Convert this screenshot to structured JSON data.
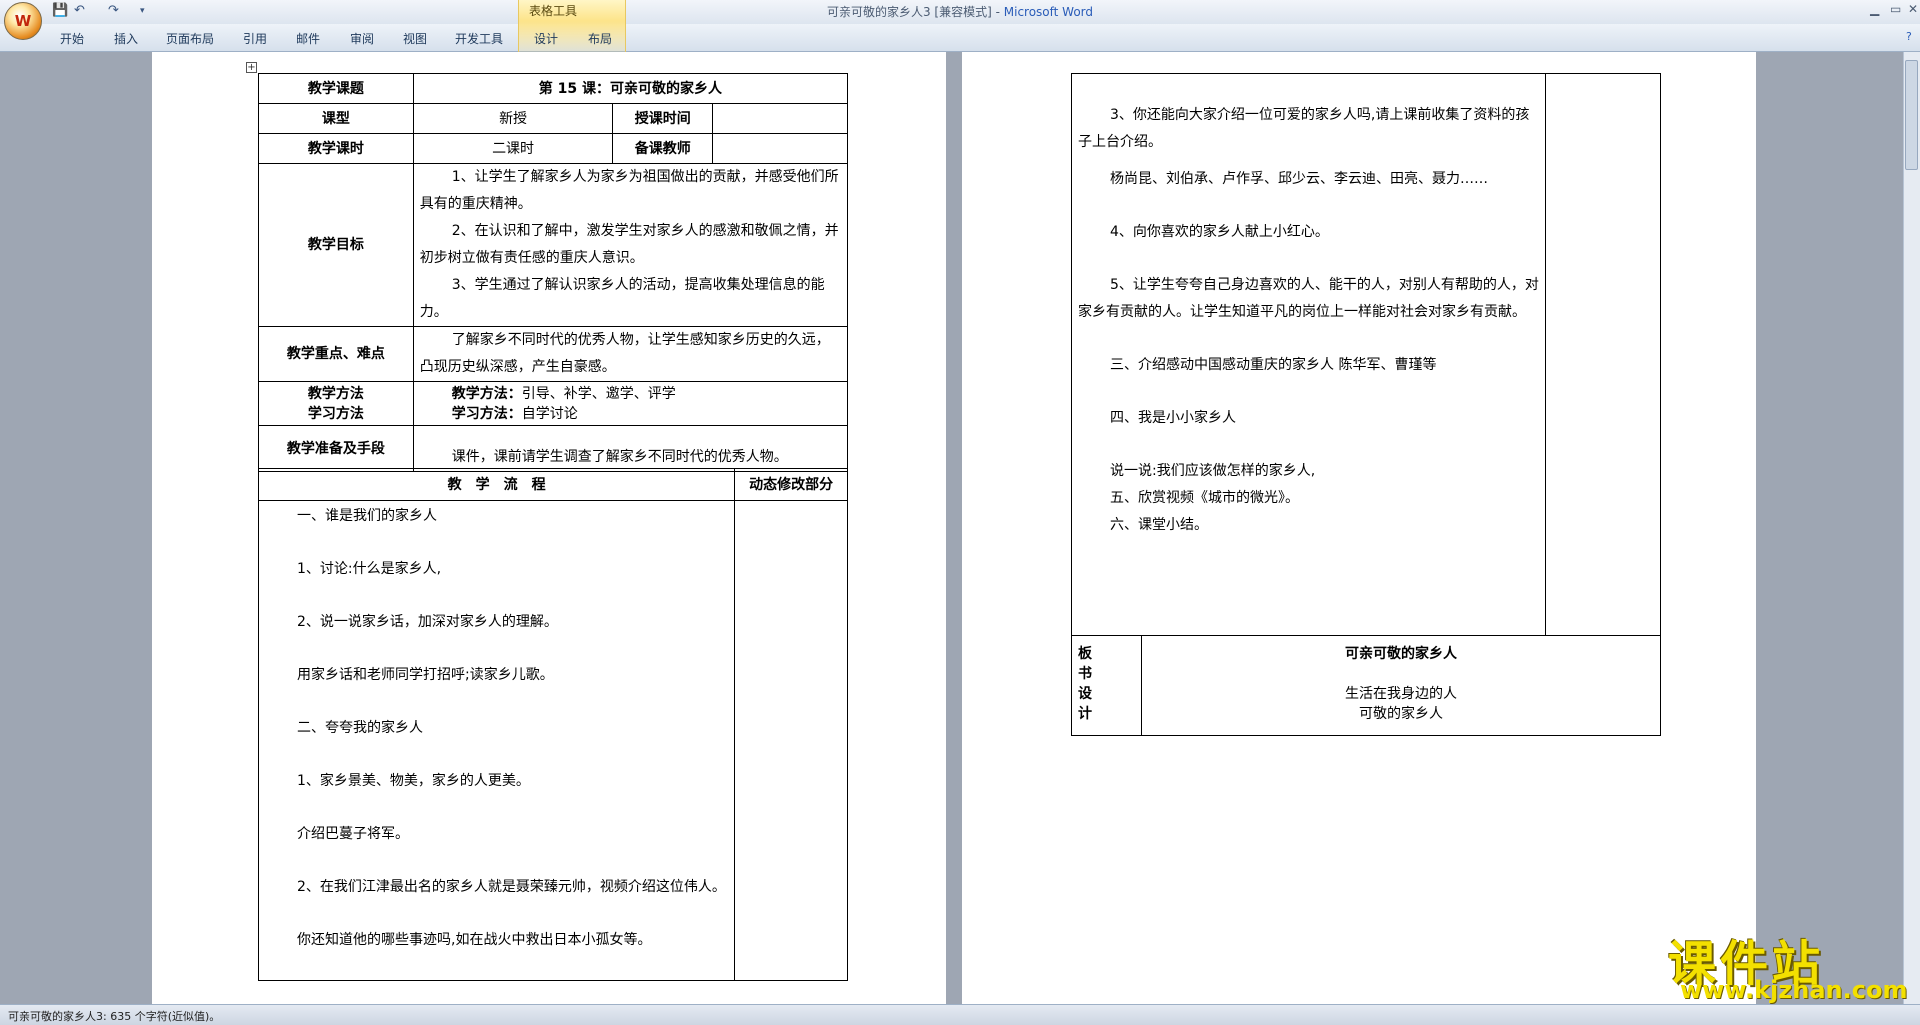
{
  "titlebar": {
    "doc_title": "可亲可敬的家乡人3 [兼容模式] - ",
    "app_name": "Microsoft Word",
    "table_tools": "表格工具"
  },
  "ribbon": {
    "tabs": [
      "开始",
      "插入",
      "页面布局",
      "引用",
      "邮件",
      "审阅",
      "视图",
      "开发工具",
      "设计",
      "布局"
    ]
  },
  "page1": {
    "r1": {
      "label": "教学课题",
      "value": "第 15 课：可亲可敬的家乡人"
    },
    "r2": {
      "label": "课型",
      "value": "新授",
      "label2": "授课时间"
    },
    "r3": {
      "label": "教学课时",
      "value": "二课时",
      "label2": "备课教师"
    },
    "goals": {
      "label": "教学目标",
      "items": [
        "1、让学生了解家乡人为家乡为祖国做出的贡献，并感受他们所具有的重庆精神。",
        "2、在认识和了解中，激发学生对家乡人的感激和敬佩之情，并初步树立做有责任感的重庆人意识。",
        "3、学生通过了解认识家乡人的活动，提高收集处理信息的能力。"
      ]
    },
    "focus": {
      "label": "教学重点、难点",
      "value": "了解家乡不同时代的优秀人物，让学生感知家乡历史的久远，凸现历史纵深感，产生自豪感。"
    },
    "method": {
      "label1": "教学方法",
      "label2": "学习方法",
      "t_label": "教学方法：",
      "t_value": "引导、补学、邀学、评学",
      "l_label": "学习方法：",
      "l_value": "自学讨论"
    },
    "prep": {
      "label": "教学准备及手段",
      "value": "课件，课前请学生调查了解家乡不同时代的优秀人物。"
    },
    "flow_header": "教　学　流　程",
    "dyn_header": "动态修改部分",
    "flow": [
      "一、谁是我们的家乡人",
      "",
      "1、讨论:什么是家乡人,",
      "",
      "2、说一说家乡话，加深对家乡人的理解。",
      "",
      "用家乡话和老师同学打招呼;读家乡儿歌。",
      "",
      "二、夸夸我的家乡人",
      "",
      "1、家乡景美、物美，家乡的人更美。",
      "",
      "介绍巴蔓子将军。",
      "",
      "2、在我们江津最出名的家乡人就是聂荣臻元帅，视频介绍这位伟人。",
      "",
      "你还知道他的哪些事迹吗,如在战火中救出日本小孤女等。"
    ]
  },
  "page2": {
    "flow": [
      "",
      "3、你还能向大家介绍一位可爱的家乡人吗,请上课前收集了资料的孩子上台介绍。",
      "杨尚昆、刘伯承、卢作孚、邱少云、李云迪、田亮、聂力……",
      "",
      "4、向你喜欢的家乡人献上小红心。",
      "",
      "5、让学生夸夸自己身边喜欢的人、能干的人，对别人有帮助的人，对家乡有贡献的人。让学生知道平凡的岗位上一样能对社会对家乡有贡献。",
      "",
      "三、介绍感动中国感动重庆的家乡人 陈华军、曹瑾等",
      "",
      "四、我是小小家乡人",
      "",
      "说一说:我们应该做怎样的家乡人,",
      "五、欣赏视频《城市的微光》。",
      "六、课堂小结。",
      "",
      ""
    ],
    "board": {
      "label_chars": [
        "板",
        "书",
        "设",
        "计"
      ],
      "title": "可亲可敬的家乡人",
      "line1": "生活在我身边的人",
      "line2": "可敬的家乡人"
    }
  },
  "statusbar": {
    "text": "可亲可敬的家乡人3: 635 个字符(近似值)。"
  },
  "watermark": {
    "big": "课件站",
    "url": "www.kjzhan.com"
  }
}
